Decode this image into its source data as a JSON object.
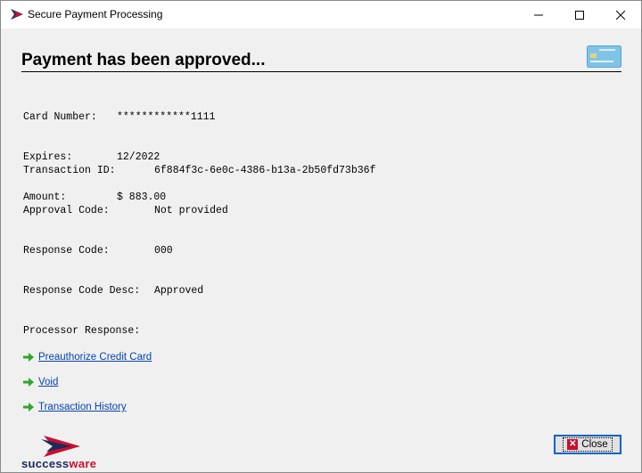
{
  "window": {
    "title": "Secure Payment Processing"
  },
  "heading": "Payment has been approved...",
  "card": [
    {
      "label": "Card Number:",
      "value": "************1111"
    },
    {
      "label": "Expires:",
      "value": "12/2022"
    },
    {
      "label": "Amount:",
      "value": "$ 883.00"
    }
  ],
  "transaction": [
    {
      "label": "Transaction ID:",
      "value": "6f884f3c-6e0c-4386-b13a-2b50fd73b36f"
    },
    {
      "label": "Approval Code:",
      "value": "Not provided"
    },
    {
      "label": "Response Code:",
      "value": "000"
    },
    {
      "label": "Response Code Desc:",
      "value": "Approved"
    },
    {
      "label": "Processor Response:",
      "value": ""
    }
  ],
  "links": [
    {
      "label": "Preauthorize Credit Card",
      "icon": "green-arrow-icon"
    },
    {
      "label": "Void",
      "icon": "green-arrow-icon"
    },
    {
      "label": "Transaction History",
      "icon": "green-arrow-icon"
    }
  ],
  "logo": {
    "part1": "success",
    "part2": "ware"
  },
  "buttons": {
    "close": "Close"
  },
  "colors": {
    "link": "#0645ad",
    "arrow": "#2fa52f",
    "brand_navy": "#1d2a5a",
    "brand_red": "#c8102e",
    "focus_border": "#0b63c8"
  }
}
